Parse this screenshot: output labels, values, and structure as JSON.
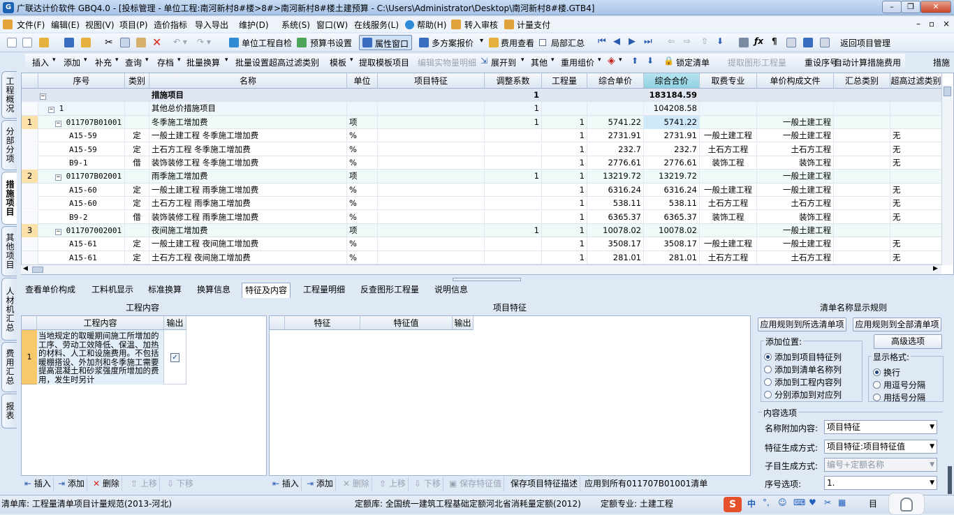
{
  "window": {
    "title": "广联达计价软件 GBQ4.0 - [投标管理 - 单位工程:南河新村8#楼>8#>南河新村8#楼土建预算 - C:\\Users\\Administrator\\Desktop\\南河新村8#楼.GTB4]"
  },
  "menu": [
    "文件(F)",
    "编辑(E)",
    "视图(V)",
    "项目(P)",
    "造价指标",
    "导入导出",
    "维护(D)",
    "系统(S)",
    "窗口(W)",
    "在线服务(L)",
    "帮助(H)",
    "转入审核",
    "计量支付"
  ],
  "toolbar1": {
    "self_check": "单位工程自检",
    "budget_setting": "预算书设置",
    "property_window": "属性窗口",
    "multi_quote": "多方案报价",
    "fee_view": "费用查看",
    "partial_summary": "局部汇总",
    "back_to_project": "返回项目管理"
  },
  "toolbar2": [
    "插入",
    "添加",
    "补充",
    "查询",
    "存档",
    "批量换算",
    "批量设置超高过滤类别",
    "模板",
    "提取模板项目",
    "编辑实物量明细",
    "展开到",
    "其他",
    "重用组价",
    "锁定清单",
    "提取图形工程量",
    "重设序号",
    "自动计算措施费用",
    "措施"
  ],
  "left_tabs": [
    "工程概况",
    "分部分项",
    "措施项目",
    "其他项目",
    "人材机汇总",
    "费用汇总",
    "报表"
  ],
  "grid": {
    "columns": [
      "序号",
      "类别",
      "名称",
      "单位",
      "项目特征",
      "调整系数",
      "工程量",
      "综合单价",
      "综合合价",
      "取费专业",
      "单价构成文件",
      "汇总类别",
      "超高过滤类别"
    ],
    "rows": [
      {
        "seq": "",
        "code": "",
        "type": "",
        "name": "措施项目",
        "unit": "",
        "feature": "",
        "coef": "1",
        "qty": "",
        "price": "",
        "total": "183184.59",
        "major": "",
        "file": "",
        "sum": "",
        "filter": ""
      },
      {
        "seq": "",
        "code": "1",
        "type": "",
        "name": "其他总价措施项目",
        "unit": "",
        "feature": "",
        "coef": "1",
        "qty": "",
        "price": "",
        "total": "104208.58",
        "major": "",
        "file": "",
        "sum": "",
        "filter": ""
      },
      {
        "seq": "1",
        "code": "011707B01001",
        "type": "",
        "name": "冬季施工增加费",
        "unit": "项",
        "feature": "",
        "coef": "1",
        "qty": "1",
        "price": "5741.22",
        "total": "5741.22",
        "major": "",
        "file": "一般土建工程",
        "sum": "",
        "filter": ""
      },
      {
        "seq": "",
        "code": "A15-59",
        "type": "定",
        "name": "一般土建工程 冬季施工增加费",
        "unit": "%",
        "feature": "",
        "coef": "",
        "qty": "1",
        "price": "2731.91",
        "total": "2731.91",
        "major": "一般土建工程",
        "file": "一般土建工程",
        "sum": "",
        "filter": "无"
      },
      {
        "seq": "",
        "code": "A15-59",
        "type": "定",
        "name": "土石方工程 冬季施工增加费",
        "unit": "%",
        "feature": "",
        "coef": "",
        "qty": "1",
        "price": "232.7",
        "total": "232.7",
        "major": "土石方工程",
        "file": "土石方工程",
        "sum": "",
        "filter": "无"
      },
      {
        "seq": "",
        "code": "B9-1",
        "type": "借",
        "name": "装饰装修工程 冬季施工增加费",
        "unit": "%",
        "feature": "",
        "coef": "",
        "qty": "1",
        "price": "2776.61",
        "total": "2776.61",
        "major": "装饰工程",
        "file": "装饰工程",
        "sum": "",
        "filter": "无"
      },
      {
        "seq": "2",
        "code": "011707B02001",
        "type": "",
        "name": "雨季施工增加费",
        "unit": "项",
        "feature": "",
        "coef": "1",
        "qty": "1",
        "price": "13219.72",
        "total": "13219.72",
        "major": "",
        "file": "一般土建工程",
        "sum": "",
        "filter": ""
      },
      {
        "seq": "",
        "code": "A15-60",
        "type": "定",
        "name": "一般土建工程 雨季施工增加费",
        "unit": "%",
        "feature": "",
        "coef": "",
        "qty": "1",
        "price": "6316.24",
        "total": "6316.24",
        "major": "一般土建工程",
        "file": "一般土建工程",
        "sum": "",
        "filter": "无"
      },
      {
        "seq": "",
        "code": "A15-60",
        "type": "定",
        "name": "土石方工程 雨季施工增加费",
        "unit": "%",
        "feature": "",
        "coef": "",
        "qty": "1",
        "price": "538.11",
        "total": "538.11",
        "major": "土石方工程",
        "file": "土石方工程",
        "sum": "",
        "filter": "无"
      },
      {
        "seq": "",
        "code": "B9-2",
        "type": "借",
        "name": "装饰装修工程 雨季施工增加费",
        "unit": "%",
        "feature": "",
        "coef": "",
        "qty": "1",
        "price": "6365.37",
        "total": "6365.37",
        "major": "装饰工程",
        "file": "装饰工程",
        "sum": "",
        "filter": "无"
      },
      {
        "seq": "3",
        "code": "011707002001",
        "type": "",
        "name": "夜间施工增加费",
        "unit": "项",
        "feature": "",
        "coef": "1",
        "qty": "1",
        "price": "10078.02",
        "total": "10078.02",
        "major": "",
        "file": "一般土建工程",
        "sum": "",
        "filter": ""
      },
      {
        "seq": "",
        "code": "A15-61",
        "type": "定",
        "name": "一般土建工程 夜间施工增加费",
        "unit": "%",
        "feature": "",
        "coef": "",
        "qty": "1",
        "price": "3508.17",
        "total": "3508.17",
        "major": "一般土建工程",
        "file": "一般土建工程",
        "sum": "",
        "filter": "无"
      },
      {
        "seq": "",
        "code": "A15-61",
        "type": "定",
        "name": "土石方工程 夜间施工增加费",
        "unit": "%",
        "feature": "",
        "coef": "",
        "qty": "1",
        "price": "281.01",
        "total": "281.01",
        "major": "土石方工程",
        "file": "土石方工程",
        "sum": "",
        "filter": "无"
      }
    ]
  },
  "bottom_tabs": [
    "查看单价构成",
    "工料机显示",
    "标准换算",
    "换算信息",
    "特征及内容",
    "工程量明细",
    "反查图形工程量",
    "说明信息"
  ],
  "work_content": {
    "title": "工程内容",
    "col_content": "工程内容",
    "col_output": "输出",
    "row_no": "1",
    "text": "当地规定的取暖期间施工所增加的工序、劳动工效降低、保温、加热的材料、人工和设施费用。不包括暖棚搭设、外加剂和冬季施工需要提高混凝土和砂浆强度所增加的费用，发生时另计",
    "buttons": [
      "插入",
      "添加",
      "删除",
      "上移",
      "下移"
    ]
  },
  "feature_panel": {
    "title": "项目特征",
    "col_feature": "特征",
    "col_value": "特征值",
    "col_output": "输出",
    "buttons": [
      "插入",
      "添加",
      "删除",
      "上移",
      "下移",
      "保存特征值",
      "保存项目特征描述",
      "应用到所有011707B01001清单"
    ]
  },
  "rules": {
    "title": "清单名称显示规则",
    "apply_selected": "应用规则到所选清单项",
    "apply_all": "应用规则到全部清单项",
    "add_position_label": "添加位置:",
    "add_options": [
      "添加到项目特征列",
      "添加到清单名称列",
      "添加到工程内容列",
      "分别添加到对应列"
    ],
    "advanced": "高级选项",
    "display_label": "显示格式:",
    "display_options": [
      "换行",
      "用逗号分隔",
      "用括号分隔"
    ],
    "content_options_label": "内容选项",
    "name_append_label": "名称附加内容:",
    "name_append_value": "项目特征",
    "feature_gen_label": "特征生成方式:",
    "feature_gen_value": "项目特征:项目特征值",
    "sub_gen_label": "子目生成方式:",
    "sub_gen_value": "编号+定额名称",
    "seq_label": "序号选项:",
    "seq_value": "1."
  },
  "status": {
    "list_lib": "清单库:  工程量清单项目计量规范(2013-河北)",
    "quota_lib": "定额库:  全国统一建筑工程基础定额河北省消耗量定额(2012)",
    "quota_major": "定额专业:  土建工程"
  },
  "ime": [
    "中",
    "°,",
    "☺",
    "⌨",
    "♥",
    "✂",
    "▦",
    "目"
  ]
}
